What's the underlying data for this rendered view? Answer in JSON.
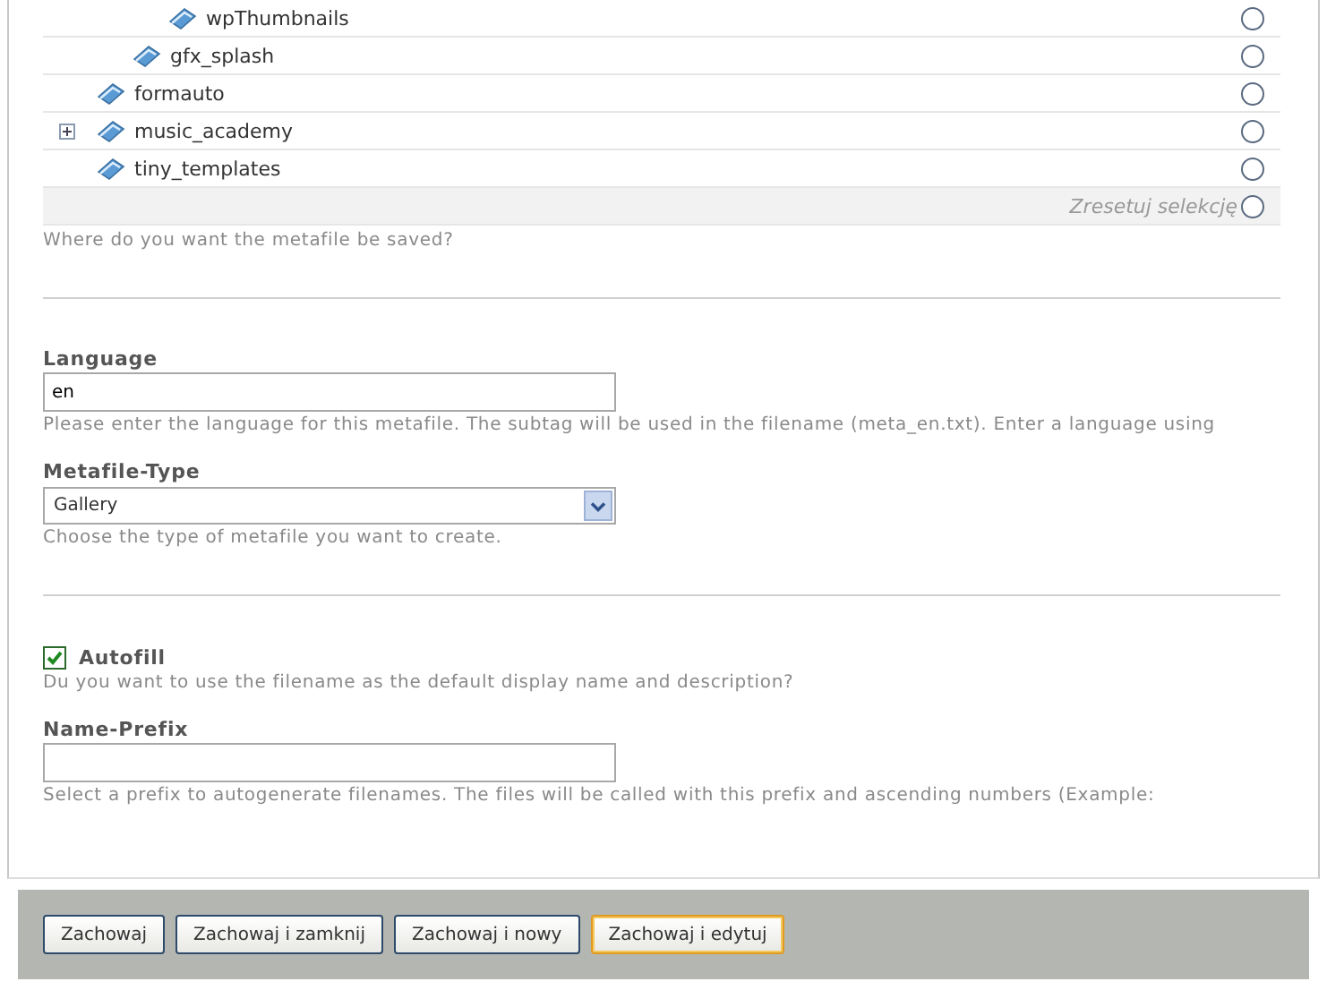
{
  "tree": {
    "items": [
      {
        "children": [
          {
            "children": [
              {
                "label": "wpThumbnails",
                "selected": false
              }
            ]
          },
          {
            "label": "gfx_splash",
            "selected": false
          }
        ]
      },
      {
        "label": "formauto",
        "selected": false
      },
      {
        "label": "music_academy",
        "expandable": true,
        "selected": false
      },
      {
        "label": "tiny_templates",
        "selected": false
      }
    ],
    "reset": {
      "label": "Zresetuj selekcję",
      "selected": false
    },
    "hint": "Where do you want the metafile be saved?"
  },
  "language": {
    "label": "Language",
    "value": "en",
    "hint": "Please enter the language for this metafile. The subtag will be used in the filename (meta_en.txt). Enter a language using"
  },
  "metafile_type": {
    "label": "Metafile-Type",
    "value": "Gallery",
    "hint": "Choose the type of metafile you want to create."
  },
  "autofill": {
    "label": "Autofill",
    "checked": true,
    "hint": "Du you want to use the filename as the default display name and description?"
  },
  "name_prefix": {
    "label": "Name-Prefix",
    "hint": "Select a prefix to autogenerate filenames. The files will be called with this prefix and ascending numbers (Example:"
  },
  "buttons": [
    {
      "label": "Zachowaj",
      "focused": false
    },
    {
      "label": "Zachowaj i zamknij",
      "focused": false
    },
    {
      "label": "Zachowaj i nowy",
      "focused": false
    },
    {
      "label": "Zachowaj i edytuj",
      "focused": true
    }
  ]
}
